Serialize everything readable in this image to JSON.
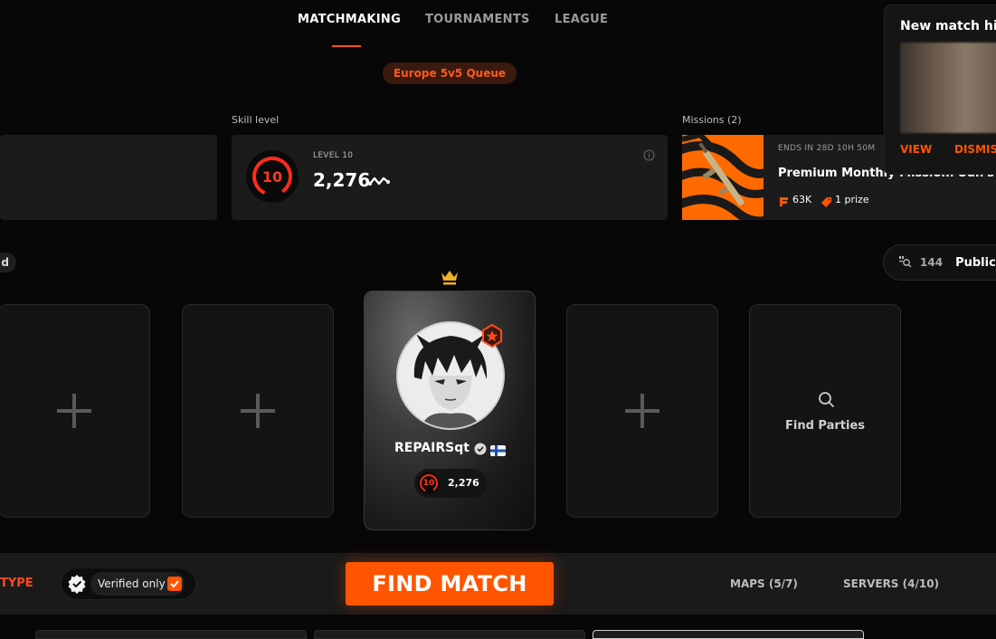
{
  "nav": {
    "tabs": [
      {
        "label": "MATCHMAKING",
        "active": true
      },
      {
        "label": "TOURNAMENTS",
        "active": false
      },
      {
        "label": "LEAGUE",
        "active": false
      }
    ]
  },
  "queue": {
    "label": "Europe 5v5 Queue"
  },
  "skill": {
    "section_label": "Skill level",
    "level_label": "LEVEL 10",
    "level_number": "10",
    "elo": "2,276"
  },
  "missions": {
    "section_label": "Missions (2)",
    "ends_in": "ENDS IN 28D 10H 50M",
    "title": "Premium Monthly Mission: Sun's Ou",
    "points": "63K",
    "prize": "1 prize"
  },
  "notification": {
    "title": "New match hig",
    "view_label": "VIEW",
    "dismiss_label": "DISMIS"
  },
  "party": {
    "left_pill_text": "d",
    "public_count": "144",
    "public_label": "Public p",
    "find_parties_label": "Find Parties"
  },
  "player": {
    "name": "REPAIRSqt",
    "level": "10",
    "elo": "2,276"
  },
  "bottom": {
    "type_label": "TYPE",
    "verified_label": "Verified only",
    "verified_checked": true,
    "find_match_label": "FIND MATCH",
    "maps_label": "MAPS (5/7)",
    "servers_label": "SERVERS (4/10)"
  },
  "colors": {
    "accent": "#ff5500",
    "background": "#070707",
    "card": "#1b1b1b"
  }
}
